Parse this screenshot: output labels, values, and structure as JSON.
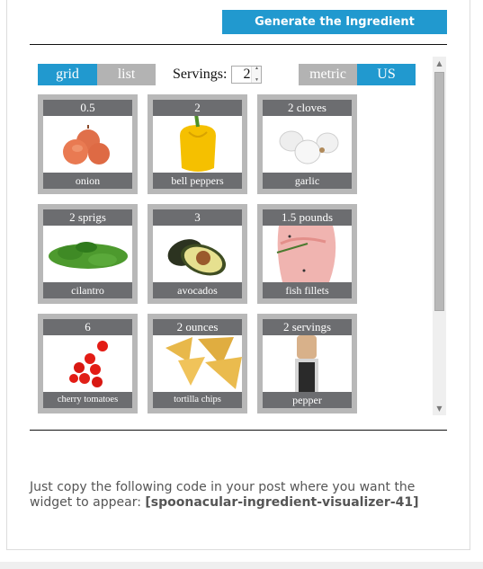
{
  "header": {
    "generate_button": "Generate the Ingredient Visualizer"
  },
  "visualizer": {
    "view_toggle": [
      {
        "label": "grid",
        "active": true
      },
      {
        "label": "list",
        "active": false
      }
    ],
    "servings": {
      "label": "Servings:",
      "value": "2"
    },
    "unit_toggle": [
      {
        "label": "metric",
        "active": false
      },
      {
        "label": "US",
        "active": true
      }
    ],
    "ingredients": [
      {
        "amount": "0.5",
        "name": "onion",
        "image": "onion"
      },
      {
        "amount": "2",
        "name": "bell peppers",
        "image": "yellow-bell-pepper"
      },
      {
        "amount": "2 cloves",
        "name": "garlic",
        "image": "garlic"
      },
      {
        "amount": "2 sprigs",
        "name": "cilantro",
        "image": "cilantro"
      },
      {
        "amount": "3",
        "name": "avocados",
        "image": "avocado"
      },
      {
        "amount": "1.5 pounds",
        "name": "fish fillets",
        "image": "fish-fillets"
      },
      {
        "amount": "6",
        "name": "cherry tomatoes",
        "image": "cherry-tomatoes"
      },
      {
        "amount": "2 ounces",
        "name": "tortilla chips",
        "image": "tortilla-chips"
      },
      {
        "amount": "2 servings",
        "name": "pepper",
        "image": "pepper-mill"
      }
    ],
    "scroll_position": 0
  },
  "footer": {
    "instructions": "Just copy the following code in your post where you want the widget to appear: ",
    "shortcode": "[spoonacular-ingredient-visualizer-41]"
  },
  "colors": {
    "accent": "#2199cf",
    "inactive": "#b3b3b3",
    "tile_frame": "#b8b8b8",
    "label_band": "#646568"
  }
}
